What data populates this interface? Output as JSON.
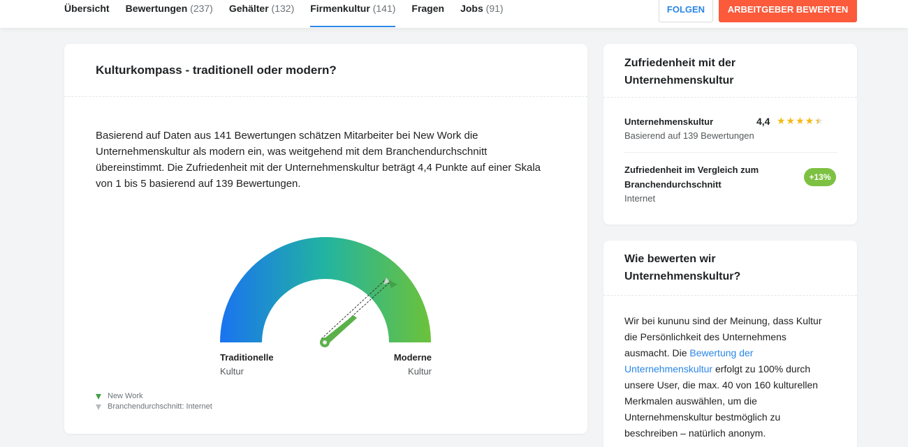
{
  "nav": {
    "tabs": [
      {
        "label": "Übersicht",
        "count": ""
      },
      {
        "label": "Bewertungen",
        "count": "(237)"
      },
      {
        "label": "Gehälter",
        "count": "(132)"
      },
      {
        "label": "Firmenkultur",
        "count": "(141)"
      },
      {
        "label": "Fragen",
        "count": ""
      },
      {
        "label": "Jobs",
        "count": "(91)"
      }
    ],
    "active_tab": "Firmenkultur",
    "follow_label": "FOLGEN",
    "rate_label": "ARBEITGEBER BEWERTEN"
  },
  "compass": {
    "title": "Kulturkompass - traditionell oder modern?",
    "description": "Basierend auf Daten aus 141 Bewertungen schätzen Mitarbeiter bei New Work die Unternehmenskultur als modern ein, was weitgehend mit dem Branchendurchschnitt übereinstimmt. Die Zufriedenheit mit der Unternehmenskultur beträgt 4,4 Punkte auf einer Skala von 1 bis 5 basierend auf 139 Bewertungen.",
    "left_label_bold": "Traditionelle",
    "left_label_sub": "Kultur",
    "right_label_bold": "Moderne",
    "right_label_sub": "Kultur",
    "legend": [
      {
        "label": "New Work",
        "color": "#43a047"
      },
      {
        "label": "Branchendurchschnitt: Internet",
        "color": "#b7bbbe"
      }
    ]
  },
  "satisfaction": {
    "title": "Zufriedenheit mit der Unternehmenskultur",
    "rating_label": "Unternehmenskultur",
    "rating_value": "4,4",
    "rating_stars": 4.4,
    "rating_sub": "Basierend auf 139 Bewertungen",
    "comparison_label": "Zufriedenheit im Vergleich zum Branchendurchschnitt",
    "comparison_sub": "Internet",
    "comparison_badge": "+13%",
    "badge_color": "#7dc142"
  },
  "how": {
    "title": "Wie bewerten wir Unternehmenskultur?",
    "text_before": "Wir bei kununu sind der Meinung, dass Kultur die Persönlichkeit des Unternehmens ausmacht. Die ",
    "link": "Bewertung der Unternehmenskultur",
    "text_after": " erfolgt zu 100% durch unsere User, die max. 40 von 160 kulturellen Merkmalen auswählen, um die Unternehmenskultur bestmöglich zu beschreiben – natürlich anonym."
  },
  "colors": {
    "accent": "#2a86e8",
    "cta": "#fb5a3b",
    "star": "#f5b916"
  }
}
